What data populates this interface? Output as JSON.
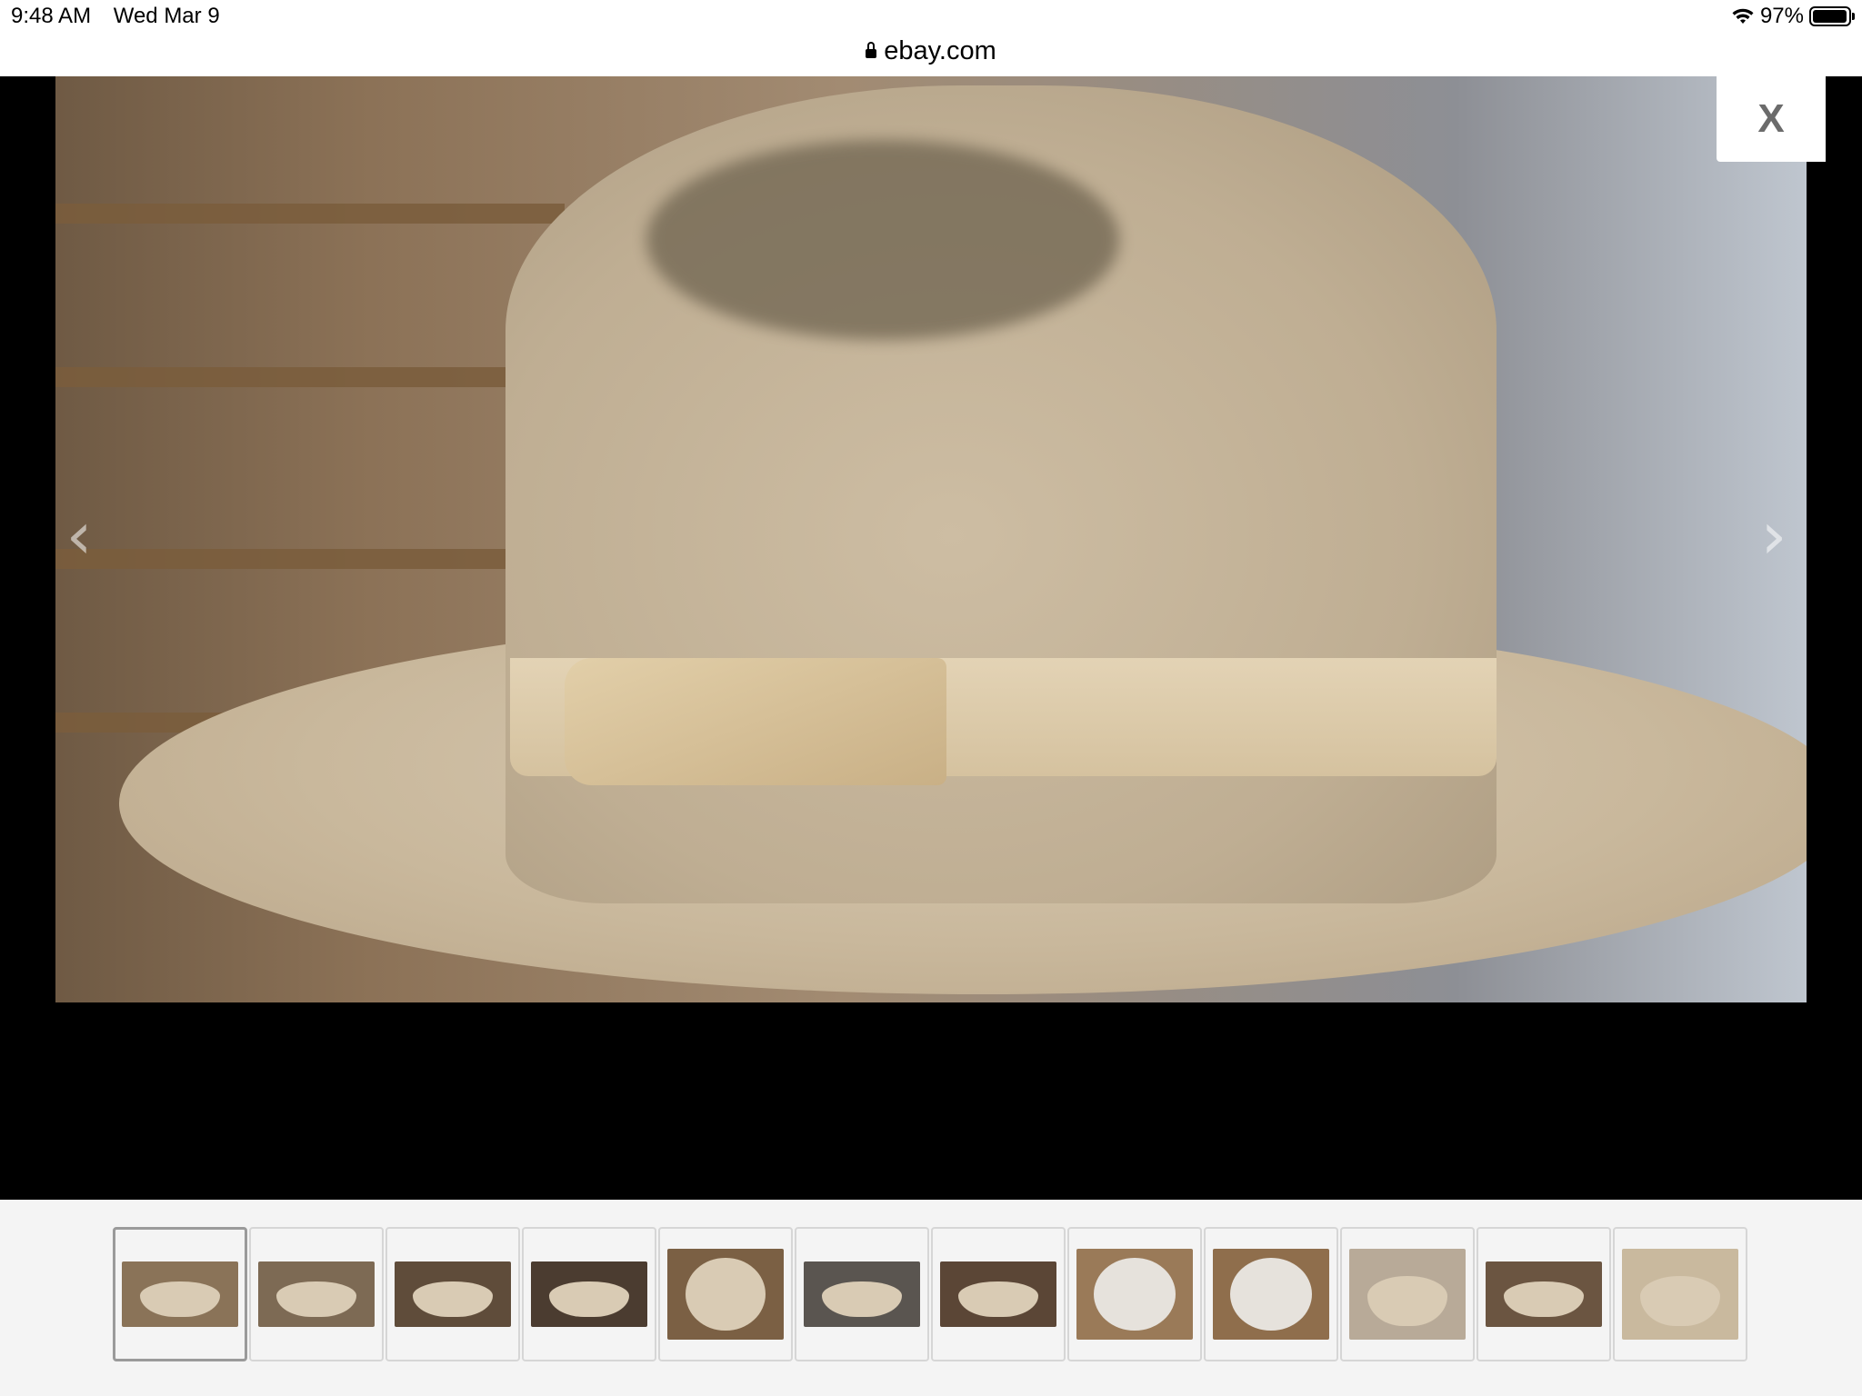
{
  "status": {
    "time": "9:48 AM",
    "date": "Wed Mar 9",
    "battery_percent": "97%",
    "battery_level": 0.97
  },
  "url_bar": {
    "domain": "ebay.com"
  },
  "viewer": {
    "close_label": "X",
    "prev_icon": "chevron-left-icon",
    "next_icon": "chevron-right-icon",
    "current_image": 1
  },
  "thumbnails": [
    {
      "id": 1,
      "kind": "hat-side",
      "bg": "#8a7358",
      "active": true
    },
    {
      "id": 2,
      "kind": "hat-side",
      "bg": "#7d6a54",
      "active": false
    },
    {
      "id": 3,
      "kind": "hat-side",
      "bg": "#5f4c3a",
      "active": false
    },
    {
      "id": 4,
      "kind": "hat-side",
      "bg": "#4b3c30",
      "active": false
    },
    {
      "id": 5,
      "kind": "hat-top",
      "bg": "#7b6044",
      "active": false
    },
    {
      "id": 6,
      "kind": "hat-side",
      "bg": "#5a5550",
      "active": false
    },
    {
      "id": 7,
      "kind": "hat-side",
      "bg": "#5b4636",
      "active": false
    },
    {
      "id": 8,
      "kind": "hat-inside",
      "bg": "#9a7a58",
      "active": false
    },
    {
      "id": 9,
      "kind": "hat-inside",
      "bg": "#8f6e4c",
      "active": false
    },
    {
      "id": 10,
      "kind": "hat-brim",
      "bg": "#b8aa98",
      "active": false
    },
    {
      "id": 11,
      "kind": "hat-side",
      "bg": "#6b5541",
      "active": false
    },
    {
      "id": 12,
      "kind": "hat-band",
      "bg": "#c9b99e",
      "active": false
    }
  ],
  "colors": {
    "viewer_bg": "#000000",
    "thumb_strip_bg": "#f4f4f4",
    "close_bg": "#ffffff"
  }
}
